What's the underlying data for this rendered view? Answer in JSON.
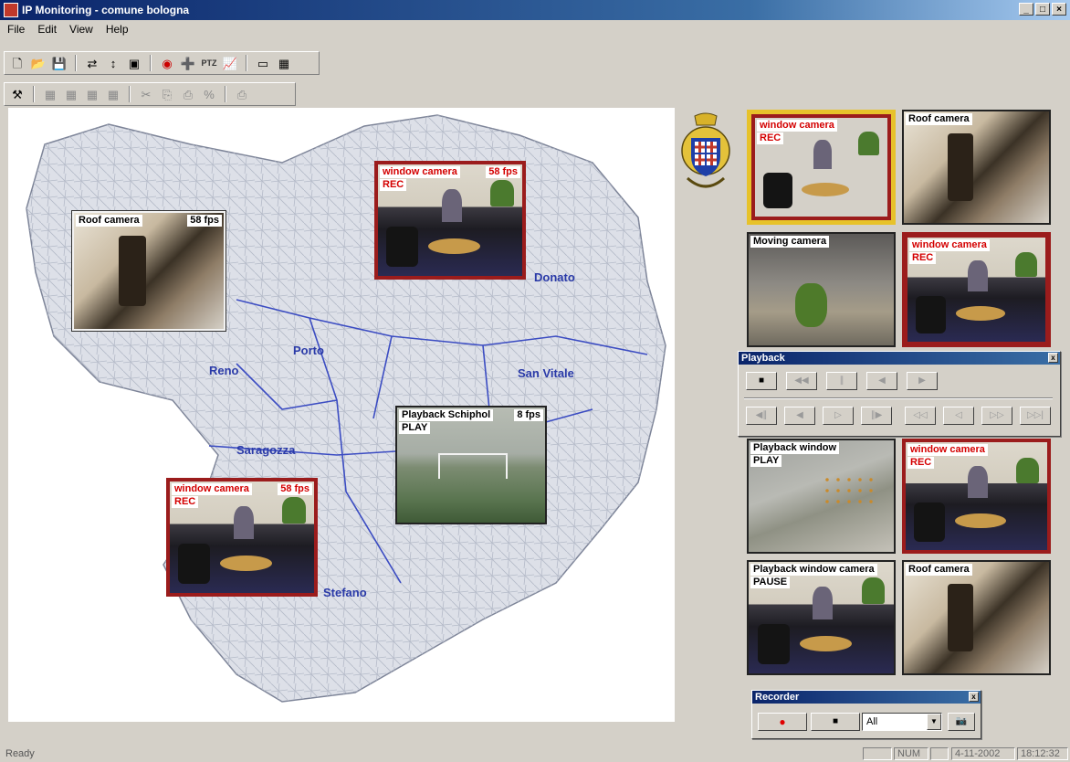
{
  "window": {
    "title": "IP Monitoring - comune bologna",
    "min": "_",
    "max": "□",
    "close": "×"
  },
  "menu": [
    "File",
    "Edit",
    "View",
    "Help"
  ],
  "toolbar1": {
    "icons": [
      "new-icon",
      "open-icon",
      "save-icon",
      "camera-link-icon",
      "network-icon",
      "properties-icon",
      "record-icon",
      "add-camera-icon",
      "ptz-icon",
      "chart-icon",
      "window-icon",
      "layout-icon"
    ],
    "glyphs": [
      "🗋",
      "📂",
      "💾",
      "⇄",
      "↕",
      "▣",
      "◉",
      "➕",
      "PTZ",
      "📈",
      "▭",
      "▦"
    ]
  },
  "toolbar2": {
    "icons": [
      "tools-icon",
      "grid4-icon",
      "grid6-icon",
      "grid9-icon",
      "grid-icon",
      "cut-icon",
      "copy-icon",
      "paste-icon",
      "zoom-icon",
      "print-icon"
    ],
    "glyphs": [
      "⚒",
      "▦",
      "▦",
      "▦",
      "▦",
      "✂",
      "⎘",
      "⎙",
      "%",
      "⎙"
    ]
  },
  "map": {
    "districts": [
      "Reno",
      "Porto",
      "San Vitale",
      "Saragozza",
      "Stefano",
      "Donato"
    ],
    "cameras": [
      {
        "caption": "Roof camera",
        "fps": "58 fps",
        "status": ""
      },
      {
        "caption": "window camera",
        "fps": "58 fps",
        "status": "REC"
      },
      {
        "caption": "Playback Schiphol",
        "fps": "8 fps",
        "status": "PLAY"
      },
      {
        "caption": "window camera",
        "fps": "58 fps",
        "status": "REC"
      }
    ]
  },
  "grid_cameras": [
    {
      "caption": "window camera",
      "status": "REC"
    },
    {
      "caption": "Roof camera",
      "status": ""
    },
    {
      "caption": "Moving camera",
      "status": ""
    },
    {
      "caption": "window camera",
      "status": "REC"
    },
    {
      "caption": "Playback window",
      "status": "PLAY"
    },
    {
      "caption": "window camera",
      "status": "REC"
    },
    {
      "caption": "Playback window camera",
      "status": "PAUSE"
    },
    {
      "caption": "Roof camera",
      "status": ""
    }
  ],
  "playback": {
    "title": "Playback",
    "row1": [
      "■",
      "◀◀",
      "∥",
      "◀",
      "▶"
    ],
    "row2": [
      "◀∥",
      "◀",
      "▷",
      "∥▶",
      "◁◁",
      "◁",
      "▷▷",
      "▷▷|"
    ]
  },
  "recorder": {
    "title": "Recorder",
    "record": "●",
    "stop": "■",
    "channel": "All",
    "snapshot": "📷"
  },
  "statusbar": {
    "ready": "Ready",
    "num": "NUM",
    "date": "4-11-2002",
    "time": "18:12:32"
  },
  "colors": {
    "titlebar": "#0a246a",
    "rec_border": "#9b1c1c",
    "selected_border": "#e7c22a",
    "district_label": "#2a3aa8"
  }
}
